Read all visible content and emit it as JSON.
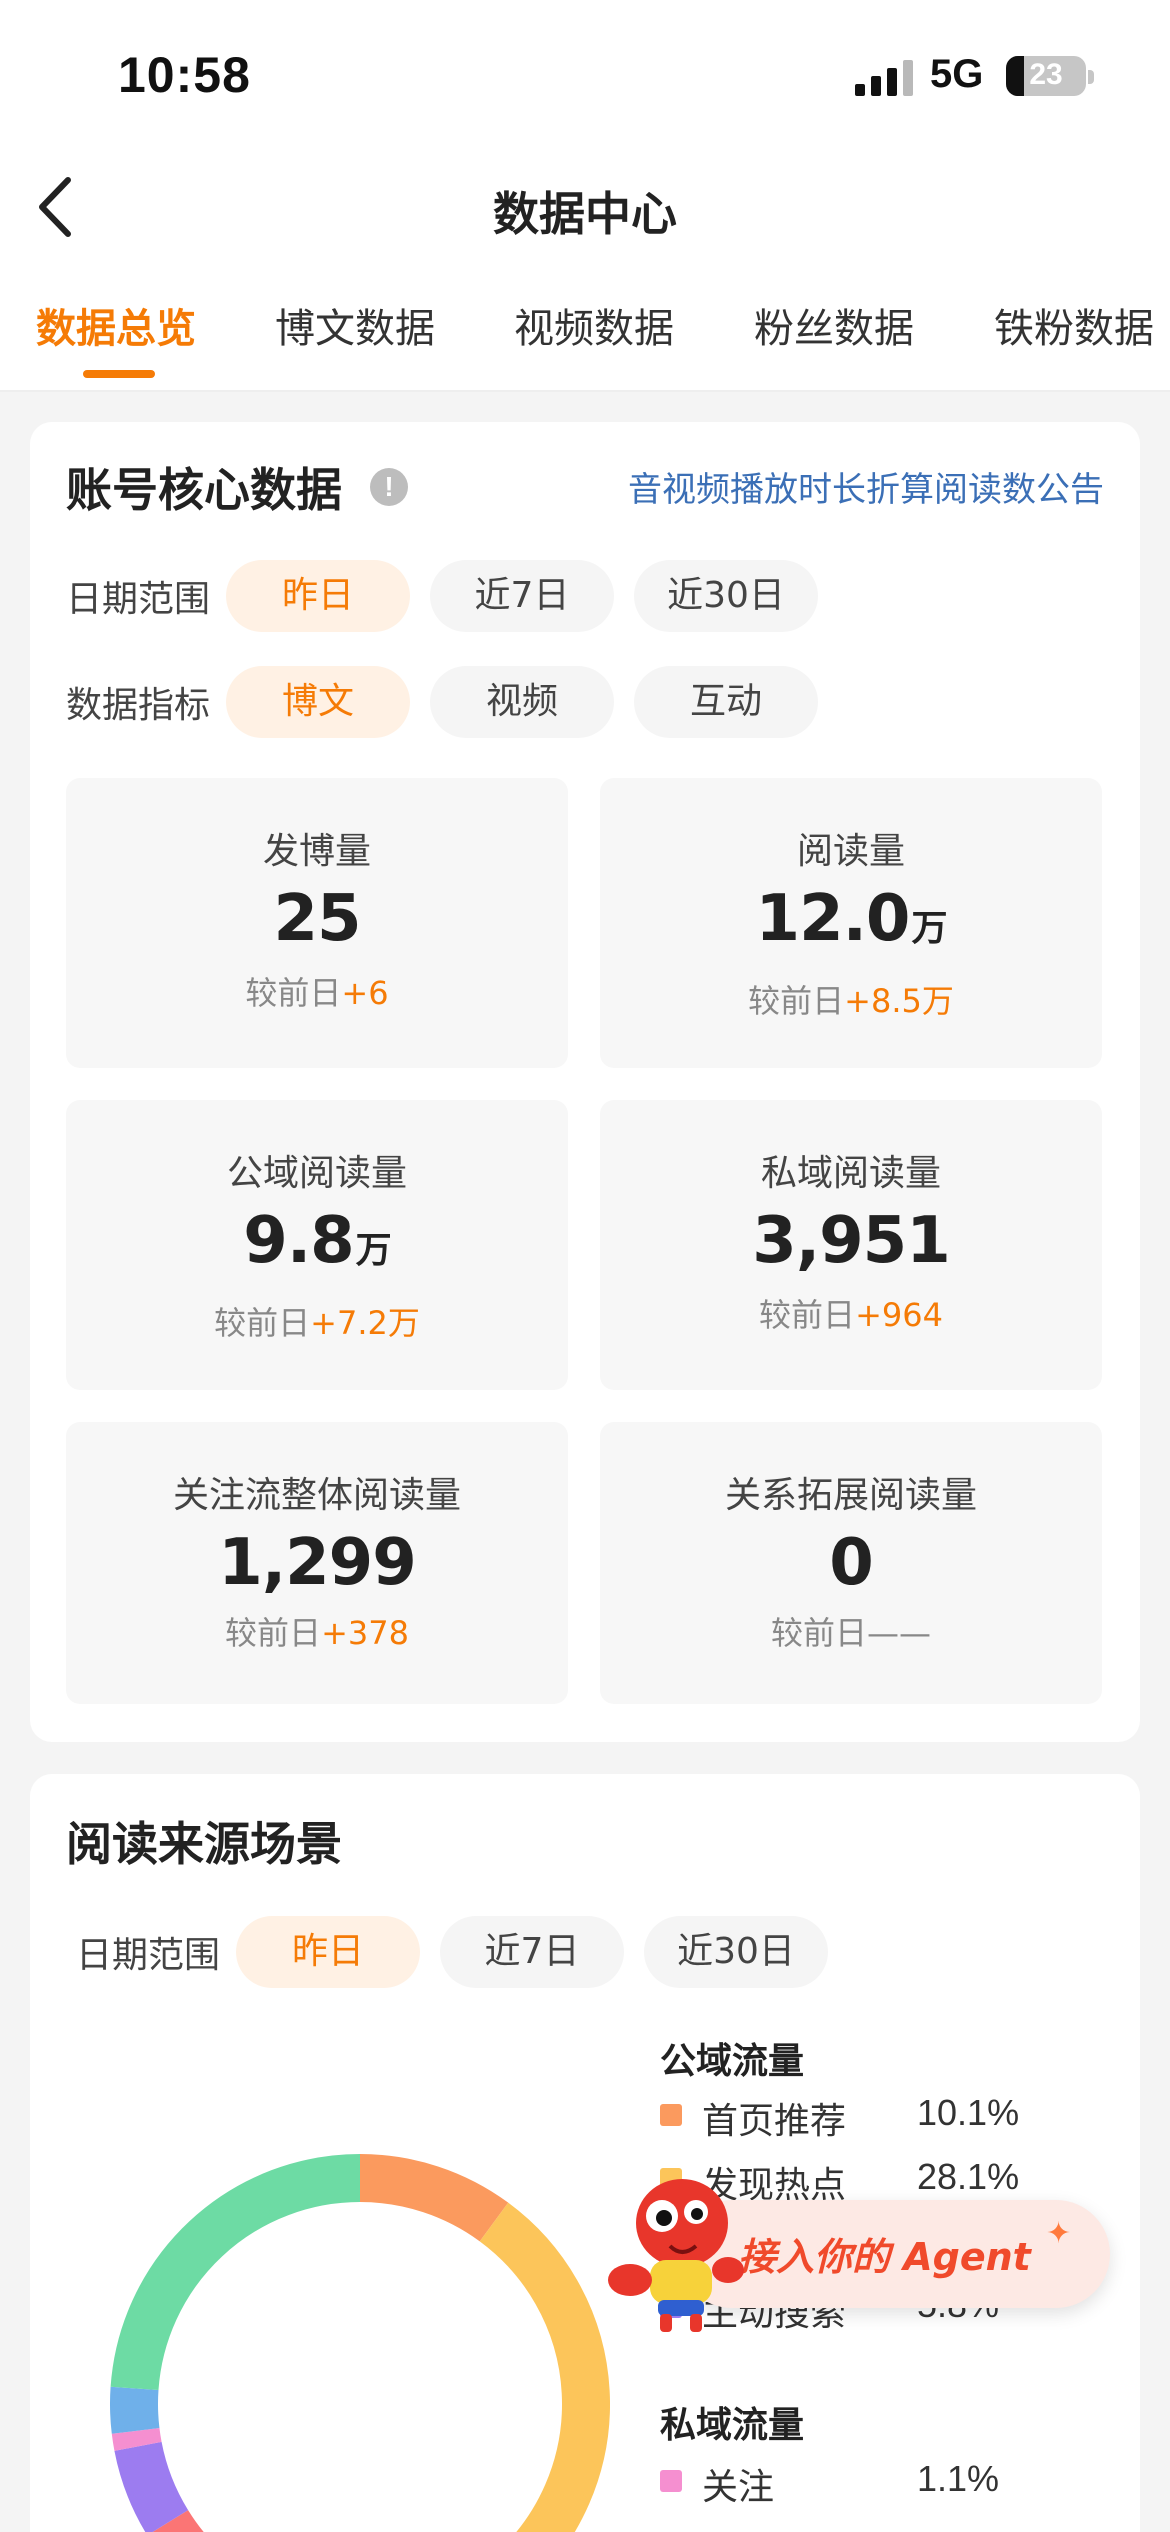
{
  "status_bar": {
    "time": "10:58",
    "network": "5G",
    "battery": "23"
  },
  "header": {
    "title": "数据中心"
  },
  "tabs": [
    {
      "label": "数据总览",
      "active": true
    },
    {
      "label": "博文数据",
      "active": false
    },
    {
      "label": "视频数据",
      "active": false
    },
    {
      "label": "粉丝数据",
      "active": false
    },
    {
      "label": "铁粉数据",
      "active": false
    }
  ],
  "core": {
    "title": "账号核心数据",
    "notice_link": "音视频播放时长折算阅读数公告",
    "date_range": {
      "label": "日期范围",
      "options": [
        "昨日",
        "近7日",
        "近30日"
      ],
      "selected": "昨日"
    },
    "metric_type": {
      "label": "数据指标",
      "options": [
        "博文",
        "视频",
        "互动"
      ],
      "selected": "博文"
    },
    "metrics": [
      {
        "label": "发博量",
        "value": "25",
        "unit": "",
        "compare_label": "较前日",
        "delta": "+6"
      },
      {
        "label": "阅读量",
        "value": "12.0",
        "unit": "万",
        "compare_label": "较前日",
        "delta": "+8.5万"
      },
      {
        "label": "公域阅读量",
        "value": "9.8",
        "unit": "万",
        "compare_label": "较前日",
        "delta": "+7.2万"
      },
      {
        "label": "私域阅读量",
        "value": "3,951",
        "unit": "",
        "compare_label": "较前日",
        "delta": "+964"
      },
      {
        "label": "关注流整体阅读量",
        "value": "1,299",
        "unit": "",
        "compare_label": "较前日",
        "delta": "+378"
      },
      {
        "label": "关系拓展阅读量",
        "value": "0",
        "unit": "",
        "compare_label": "较前日",
        "delta": "——"
      }
    ]
  },
  "sources": {
    "title": "阅读来源场景",
    "date_range": {
      "label": "日期范围",
      "options": [
        "昨日",
        "近7日",
        "近30日"
      ],
      "selected": "昨日"
    },
    "public_title": "公域流量",
    "private_title": "私域流量",
    "public_items": [
      {
        "name": "首页推荐",
        "pct": "10.1%",
        "color": "#fb9a5e"
      },
      {
        "name": "发现热点",
        "pct": "28.1%",
        "color": "#fcc55a"
      },
      {
        "name": "主动搜索",
        "pct": "5.8%",
        "color": "#9c7cf0"
      }
    ],
    "private_items": [
      {
        "name": "关注",
        "pct": "1.1%",
        "color": "#f58fd0"
      }
    ],
    "agent_button": "接入你的 Agent"
  },
  "chart_data": {
    "type": "pie",
    "donut": true,
    "slices": [
      {
        "label": "首页推荐",
        "value": 10.1,
        "color": "#fb9a5e"
      },
      {
        "label": "发现热点",
        "value": 28.1,
        "color": "#fcc55a"
      },
      {
        "label": "",
        "value": 28.0,
        "color": "#fb7575"
      },
      {
        "label": "主动搜索",
        "value": 5.8,
        "color": "#9c7cf0"
      },
      {
        "label": "关注",
        "value": 1.1,
        "color": "#f58fd0"
      },
      {
        "label": "",
        "value": 3.0,
        "color": "#6fb0ea"
      },
      {
        "label": "",
        "value": 23.9,
        "color": "#6ddba4"
      }
    ]
  }
}
